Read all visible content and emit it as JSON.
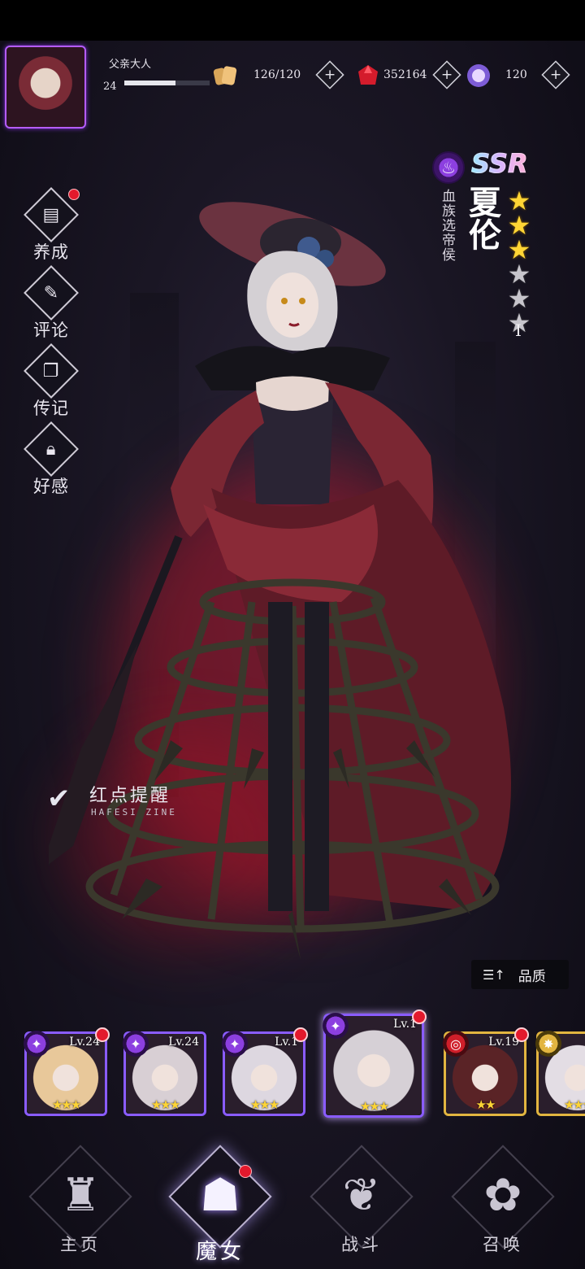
{
  "player": {
    "name": "父亲大人",
    "level": "24",
    "xp_fraction": 0.6
  },
  "resources": [
    {
      "id": "stamina",
      "icon": "bread-icon",
      "value": "126/120",
      "color": "#e8b86b"
    },
    {
      "id": "ruby",
      "icon": "red-gem-icon",
      "value": "352164",
      "color": "#d41c2c"
    },
    {
      "id": "crystal",
      "icon": "crystal-icon",
      "value": "120",
      "color": "#b58cff"
    }
  ],
  "side_menu": [
    {
      "id": "cultivate",
      "label": "养成",
      "icon": "scroll-icon",
      "has_dot": true
    },
    {
      "id": "comment",
      "label": "评论",
      "icon": "quill-icon",
      "has_dot": false
    },
    {
      "id": "biography",
      "label": "传记",
      "icon": "cards-icon",
      "has_dot": false
    },
    {
      "id": "affinity",
      "label": "好感",
      "icon": "lock-icon",
      "has_dot": false
    }
  ],
  "character": {
    "rarity": "SSR",
    "element_icon": "flame-icon",
    "title": "血族选帝侯",
    "name": "夏伦",
    "stars_filled": 3,
    "stars_total": 6,
    "rank": "I"
  },
  "reminder": {
    "label": "红点提醒",
    "sub": "HAFESI ZINE",
    "checked": true
  },
  "sort": {
    "icon": "sort-icon",
    "label": "品质"
  },
  "roster": [
    {
      "level": "Lv.24",
      "stars": 3,
      "element": "purple",
      "frame": "#8a5cff",
      "has_dot": true
    },
    {
      "level": "Lv.24",
      "stars": 3,
      "element": "purple",
      "frame": "#8a5cff",
      "has_dot": false
    },
    {
      "level": "Lv.1",
      "stars": 3,
      "element": "purple",
      "frame": "#8a5cff",
      "has_dot": true
    },
    {
      "level": "Lv.1",
      "stars": 3,
      "element": "purple",
      "frame": "#8a5cff",
      "has_dot": true,
      "selected": true
    },
    {
      "level": "Lv.19",
      "stars": 2,
      "element": "red",
      "frame": "#e2b540",
      "has_dot": true
    },
    {
      "level": "Lv",
      "stars": 3,
      "element": "gold",
      "frame": "#e2b540",
      "has_dot": false
    }
  ],
  "nav": [
    {
      "id": "home",
      "label": "主页",
      "icon": "castle-icon",
      "active": false,
      "has_dot": false
    },
    {
      "id": "witch",
      "label": "魔女",
      "icon": "witch-icon",
      "active": true,
      "has_dot": true
    },
    {
      "id": "battle",
      "label": "战斗",
      "icon": "book-icon",
      "active": false,
      "has_dot": false
    },
    {
      "id": "summon",
      "label": "召唤",
      "icon": "rose-icon",
      "active": false,
      "has_dot": false
    }
  ]
}
